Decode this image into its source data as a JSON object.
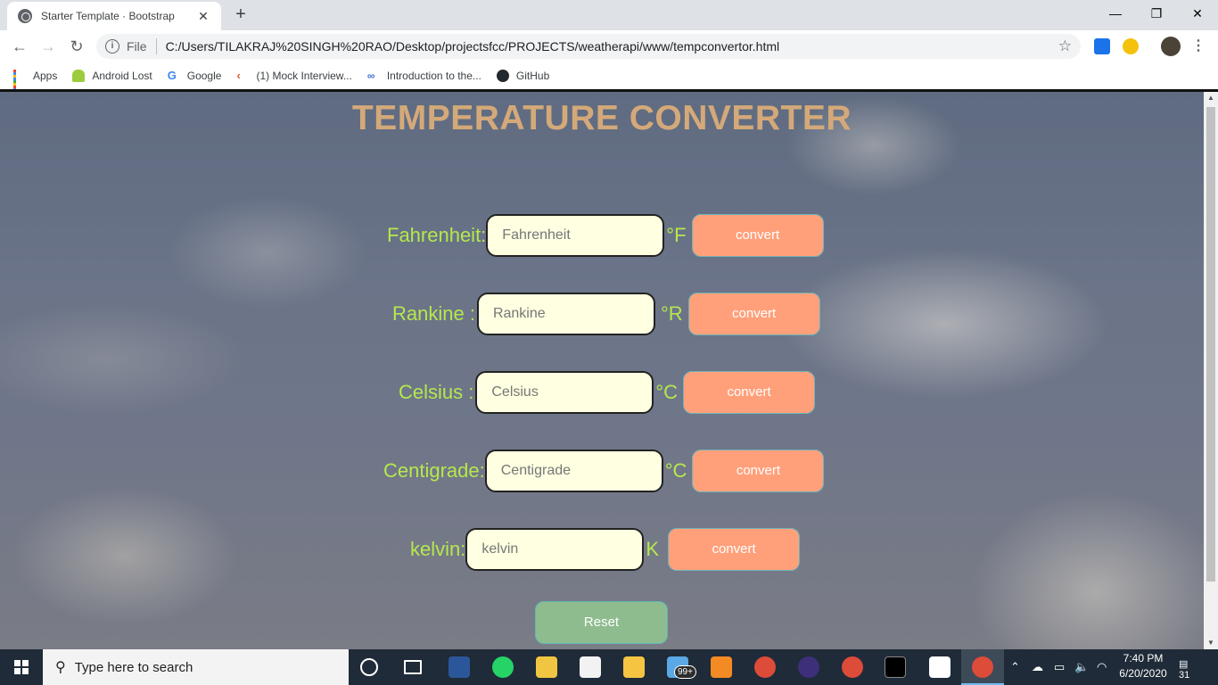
{
  "browser": {
    "tab_title": "Starter Template · Bootstrap",
    "tab_close": "✕",
    "new_tab": "+",
    "window_controls": {
      "minimize": "—",
      "restore": "❐",
      "close": "✕"
    },
    "nav": {
      "back": "←",
      "forward": "→",
      "reload": "↻"
    },
    "omnibox": {
      "scheme_label": "File",
      "url": "C:/Users/TILAKRAJ%20SINGH%20RAO/Desktop/projectsfcc/PROJECTS/weatherapi/www/tempconvertor.html",
      "star": "☆"
    },
    "bookmarks": [
      {
        "label": "Apps",
        "icon": "apps-grid-icon"
      },
      {
        "label": "Android Lost",
        "icon": "android-icon"
      },
      {
        "label": "Google",
        "icon": "google-icon"
      },
      {
        "label": "(1) Mock Interview...",
        "icon": "mock-interview-icon"
      },
      {
        "label": "Introduction to the...",
        "icon": "link-icon"
      },
      {
        "label": "GitHub",
        "icon": "github-icon"
      }
    ]
  },
  "page": {
    "title": "TEMPERATURE CONVERTER",
    "rows": [
      {
        "label": "Fahrenheit:",
        "placeholder": "Fahrenheit",
        "unit": "°F",
        "button": "convert"
      },
      {
        "label": "Rankine :",
        "placeholder": "Rankine",
        "unit": "°R",
        "button": "convert"
      },
      {
        "label": "Celsius :",
        "placeholder": "Celsius",
        "unit": "°C",
        "button": "convert"
      },
      {
        "label": "Centigrade:",
        "placeholder": "Centigrade",
        "unit": "°C",
        "button": "convert"
      },
      {
        "label": "kelvin:",
        "placeholder": "kelvin",
        "unit": "K",
        "button": "convert"
      }
    ],
    "reset_label": "Reset"
  },
  "taskbar": {
    "search_placeholder": "Type here to search",
    "search_icon": "magnifier-icon",
    "badge": "99+",
    "time": "7:40 PM",
    "date": "6/20/2020",
    "notification_count": "31"
  },
  "colors": {
    "title": "#d4a979",
    "label": "#b5e84d",
    "input_bg": "#ffffe1",
    "convert_button": "#ffa07a",
    "reset_button": "#8fbc8f"
  }
}
